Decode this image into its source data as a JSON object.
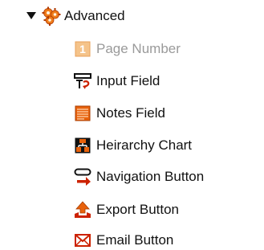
{
  "tree": {
    "parent": {
      "label": "Advanced",
      "expanded": true,
      "icon": "advanced-gears-icon"
    },
    "items": [
      {
        "label": "Page Number",
        "icon": "page-number-icon",
        "enabled": false
      },
      {
        "label": "Input Field",
        "icon": "input-field-icon",
        "enabled": true
      },
      {
        "label": "Notes Field",
        "icon": "notes-field-icon",
        "enabled": true
      },
      {
        "label": "Heirarchy Chart",
        "icon": "hierarchy-chart-icon",
        "enabled": true
      },
      {
        "label": "Navigation Button",
        "icon": "navigation-button-icon",
        "enabled": true
      },
      {
        "label": "Export Button",
        "icon": "export-button-icon",
        "enabled": true
      },
      {
        "label": "Email Button",
        "icon": "email-button-icon",
        "enabled": true
      }
    ]
  },
  "colors": {
    "accent_orange": "#e8620c",
    "accent_red": "#cc2200",
    "disabled_text": "#9a9a9a",
    "text": "#111111"
  }
}
